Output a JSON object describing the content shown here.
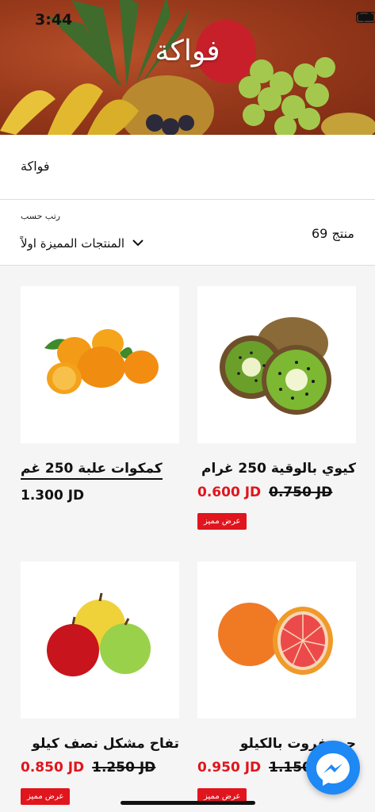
{
  "status_bar": {
    "time": "3:44"
  },
  "header": {
    "title": "فواكة"
  },
  "category": {
    "label": "فواكة"
  },
  "sort": {
    "caption": "رتب حسب",
    "selected": "المنتجات المميزة اولاً",
    "count_label": "منتج 69"
  },
  "products": [
    {
      "title": "كيوي بالوقية 250 غرام",
      "price": "0.600 JD",
      "old_price": "0.750 JD",
      "badge": "عرض مميز",
      "image": "kiwi"
    },
    {
      "title": "كمكوات علبة 250 غم",
      "price": "1.300 JD",
      "image": "kumquat"
    },
    {
      "title": "جريبفروت بالكيلو",
      "price": "0.950 JD",
      "old_price": "1.150",
      "badge": "عرض مميز",
      "image": "grapefruit"
    },
    {
      "title": "تفاح مشكل نصف كيلو",
      "price": "0.850 JD",
      "old_price": "1.250 JD",
      "badge": "عرض مميز",
      "image": "apples"
    }
  ],
  "icons": [
    "wifi-icon",
    "battery-icon",
    "chevron-down-icon",
    "messenger-icon"
  ],
  "colors": {
    "sale_red": "#e0151d",
    "messenger_blue": "#1e88f5"
  }
}
